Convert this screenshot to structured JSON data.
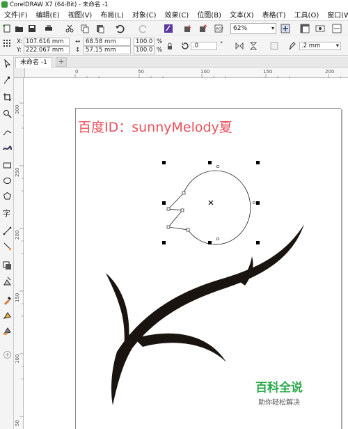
{
  "window": {
    "title": "CorelDRAW X7 (64-Bit) - 未命名 -1"
  },
  "menu": [
    "文件(F)",
    "编辑(E)",
    "视图(V)",
    "布局(L)",
    "对象(C)",
    "效果(C)",
    "位图(B)",
    "文本(X)",
    "表格(T)",
    "工具(O)",
    "窗口(W)"
  ],
  "toolbar": {
    "zoom": "62%"
  },
  "properties": {
    "x_label": "X:",
    "x_value": "107.616 mm",
    "y_label": "Y:",
    "y_value": "222.067 mm",
    "w_value": "68.58 mm",
    "h_value": "57.15 mm",
    "scale_w": "100.0",
    "scale_h": "100.0",
    "pct1": "%",
    "pct2": "%",
    "angle": ".0",
    "degree": "°",
    "outline_width": ".2 mm"
  },
  "tabs": {
    "document": "未命名 -1"
  },
  "ruler": {
    "h_ticks": [
      "0",
      "50",
      "100",
      "150",
      "200"
    ],
    "v_ticks": [
      "300",
      "250",
      "200",
      "150",
      "100",
      "50"
    ]
  },
  "canvas": {
    "text_top": "百度ID：sunnyMelody夏",
    "brand_big": "百科全说",
    "brand_small": "助你轻松解决"
  },
  "colors": {
    "watermark": "#e8505b",
    "brand": "#2aa84a",
    "stroke": "#1a1410"
  }
}
